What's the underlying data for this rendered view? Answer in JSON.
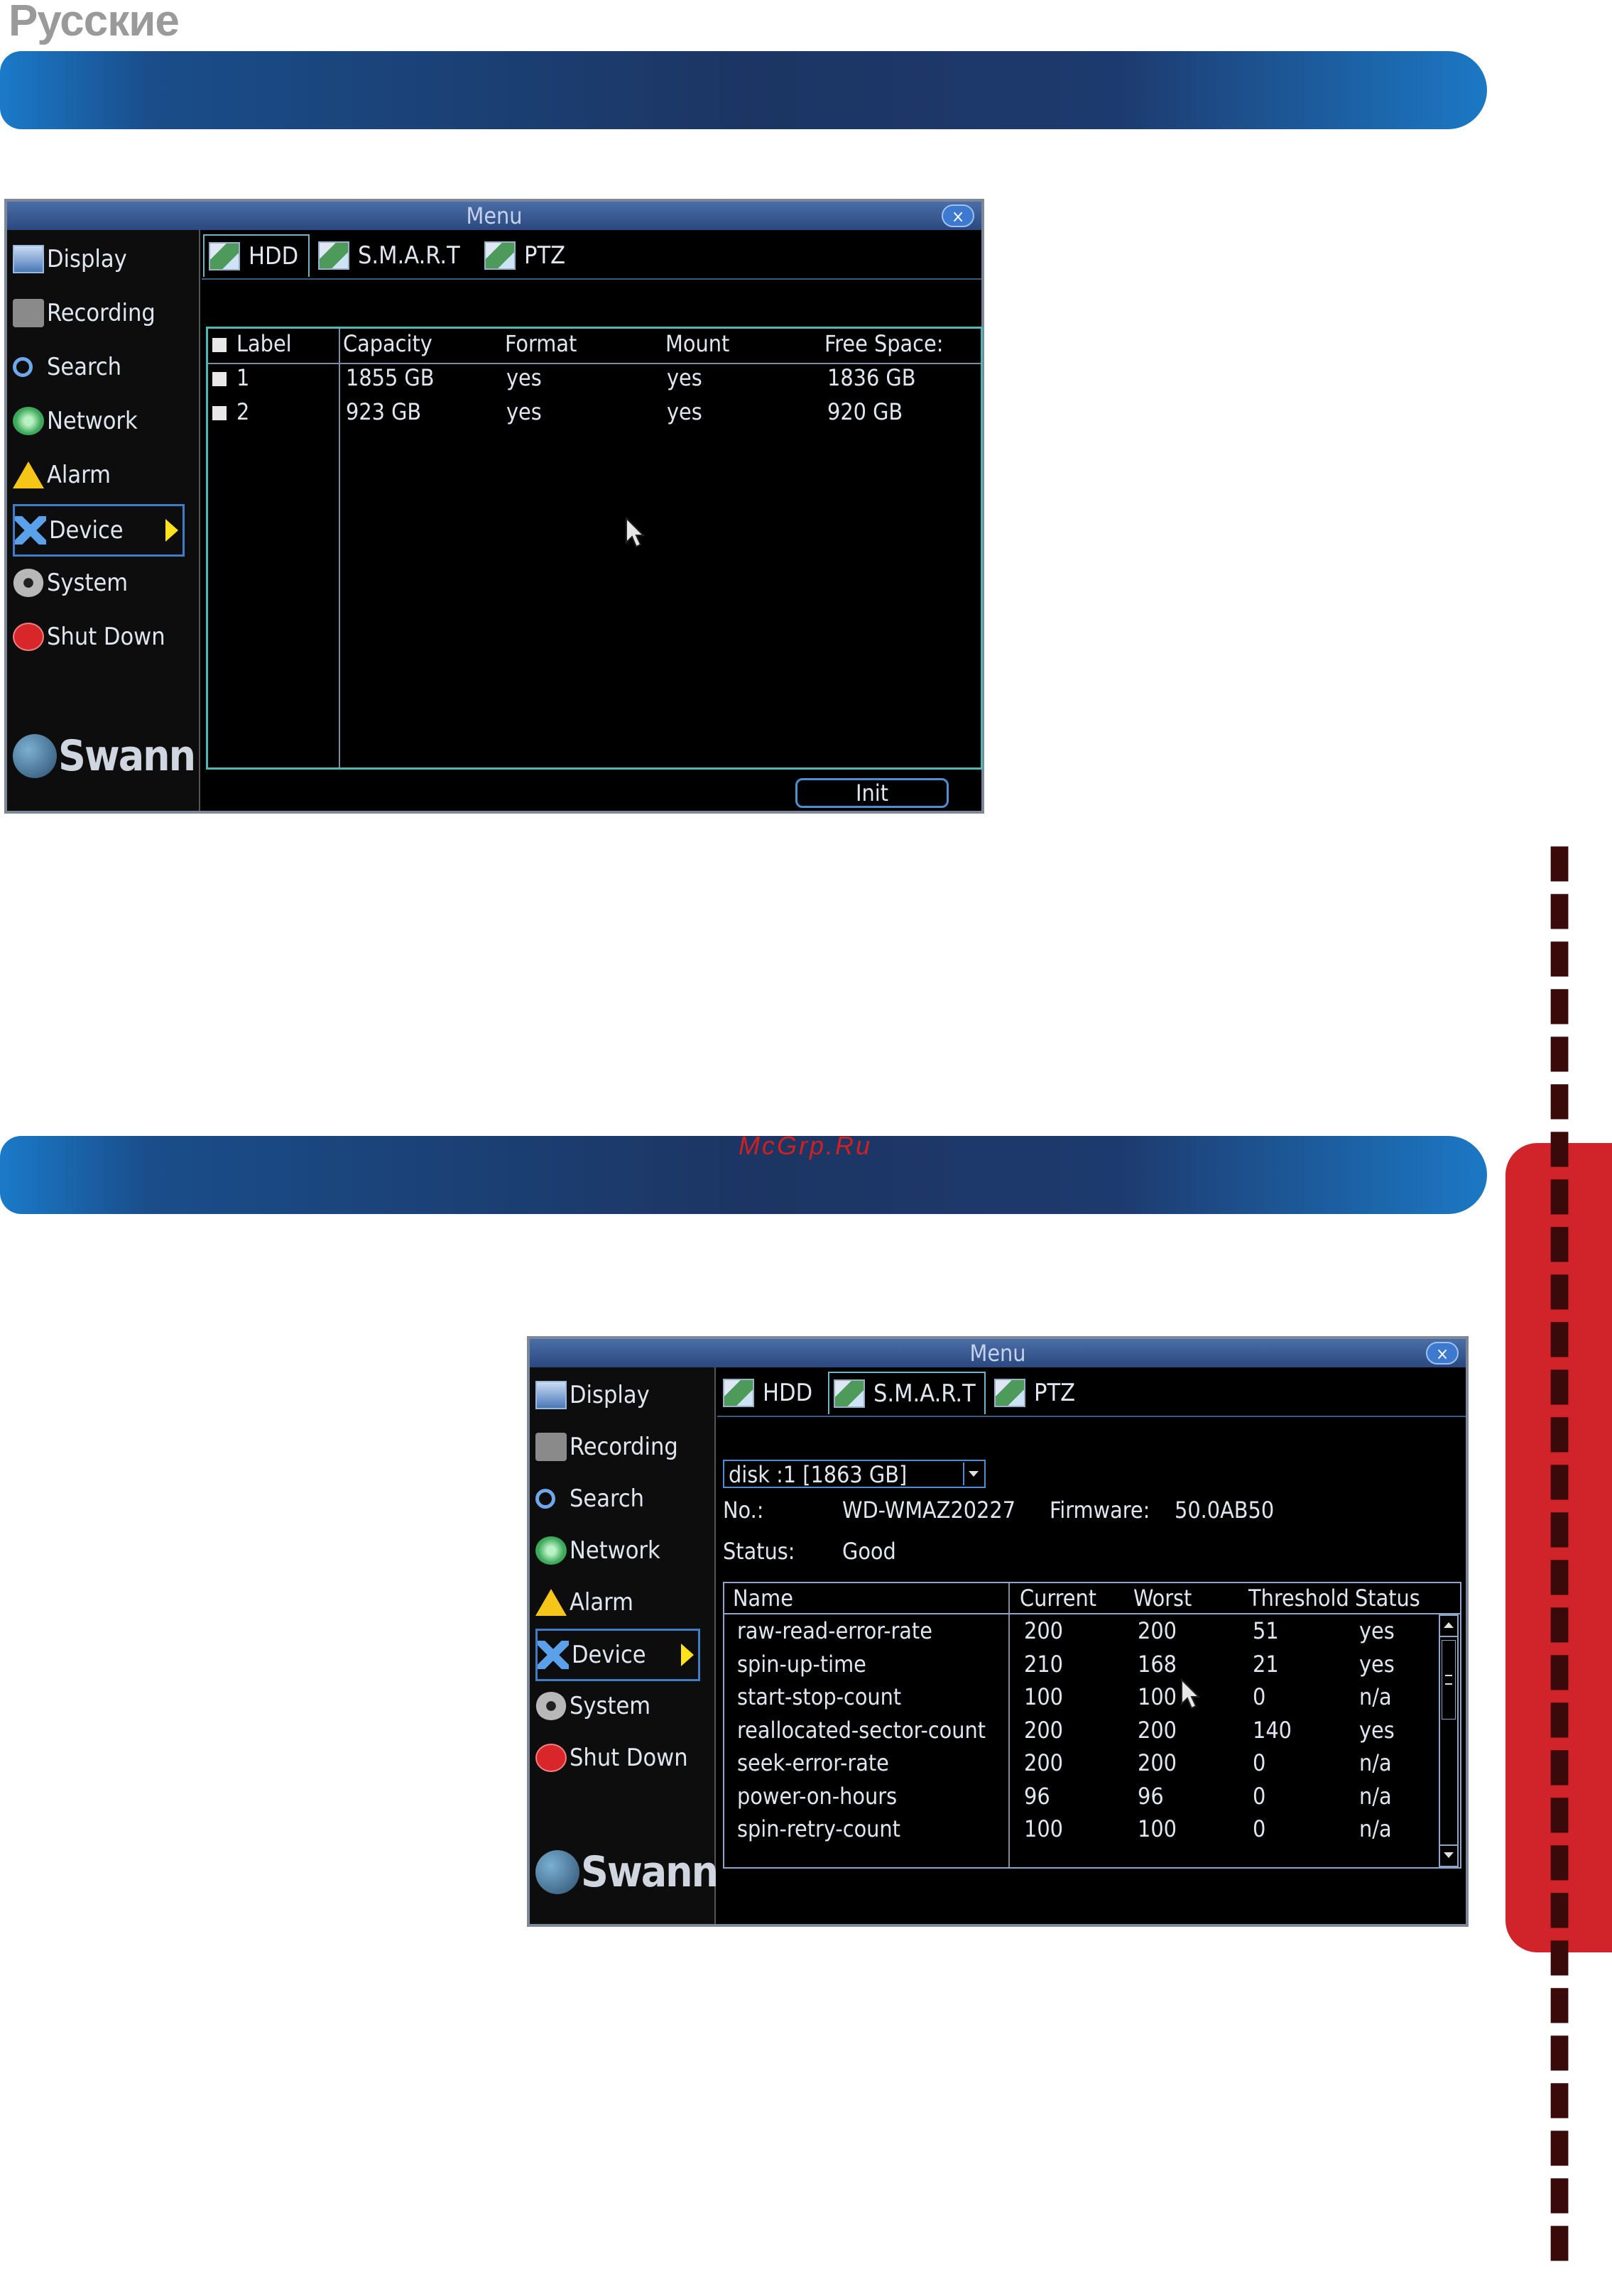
{
  "page": {
    "language_label": "Русские",
    "watermark": "McGrp.Ru",
    "side_tab_text": "▮▮▮▮▮▮▮▮▮▮▮▮▮▮▮▮▮▮▮▮▮▮▮▮▮▮▮▮▮▮"
  },
  "menu": {
    "title": "Menu",
    "close_label": "×",
    "items": [
      "Display",
      "Recording",
      "Search",
      "Network",
      "Alarm",
      "Device",
      "System",
      "Shut Down"
    ],
    "active_item": "Device",
    "logo_text": "Swann"
  },
  "tabs": [
    "HDD",
    "S.M.A.R.T",
    "PTZ"
  ],
  "hdd": {
    "columns": [
      "Label",
      "Capacity",
      "Format",
      "Mount",
      "Free Space:"
    ],
    "rows": [
      [
        "1",
        "1855 GB",
        "yes",
        "yes",
        "1836 GB"
      ],
      [
        "2",
        "923 GB",
        "yes",
        "yes",
        "920 GB"
      ]
    ],
    "init_button": "Init"
  },
  "smart": {
    "disk_select": "disk :1 [1863 GB]",
    "no_label": "No.:",
    "no_value": "WD-WMAZ20227",
    "firmware_label": "Firmware:",
    "firmware_value": "50.0AB50",
    "status_label": "Status:",
    "status_value": "Good",
    "columns": [
      "Name",
      "Current",
      "Worst",
      "Threshold",
      "Status"
    ],
    "rows": [
      [
        "raw-read-error-rate",
        "200",
        "200",
        "51",
        "yes"
      ],
      [
        "spin-up-time",
        "210",
        "168",
        "21",
        "yes"
      ],
      [
        "start-stop-count",
        "100",
        "100",
        "0",
        "n/a"
      ],
      [
        "reallocated-sector-count",
        "200",
        "200",
        "140",
        "yes"
      ],
      [
        "seek-error-rate",
        "200",
        "200",
        "0",
        "n/a"
      ],
      [
        "power-on-hours",
        "96",
        "96",
        "0",
        "n/a"
      ],
      [
        "spin-retry-count",
        "100",
        "100",
        "0",
        "n/a"
      ]
    ]
  }
}
